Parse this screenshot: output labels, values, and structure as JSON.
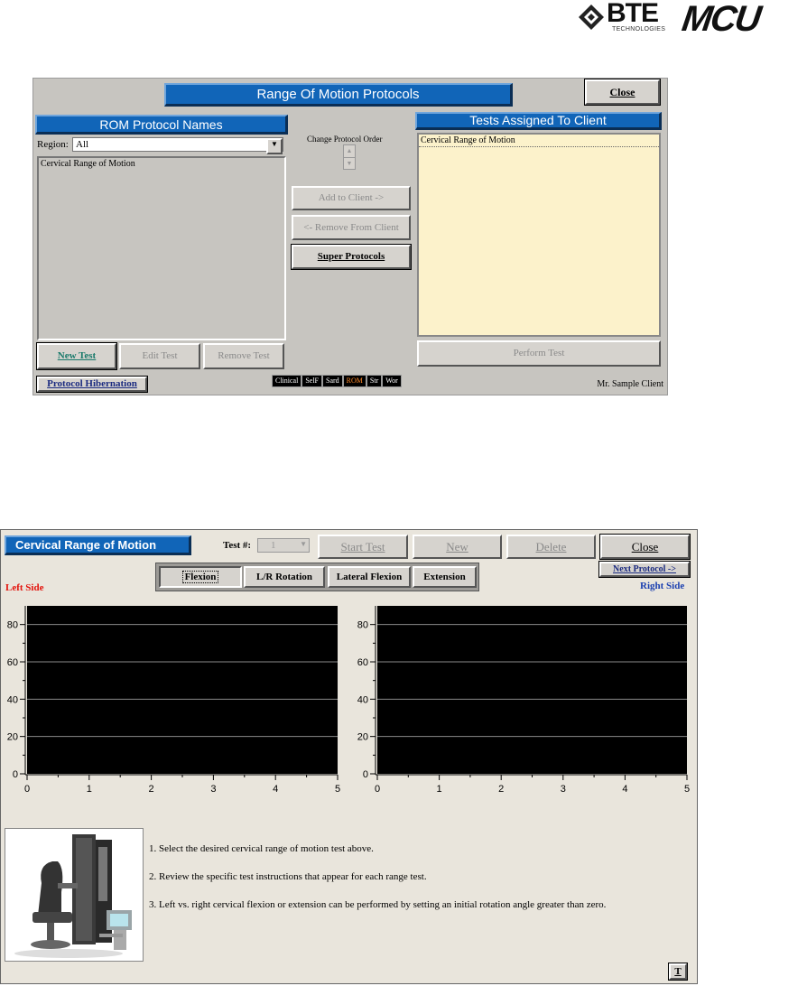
{
  "logos": {
    "bte_text": "BTE",
    "bte_subtext": "TECHNOLOGIES",
    "mcu_text": "MCU"
  },
  "protocols_window": {
    "title": "Range Of Motion Protocols",
    "close_label": "Close",
    "rom_names_header": "ROM Protocol Names",
    "region_label": "Region:",
    "region_value": "All",
    "protocol_names": [
      "Cervical Range of Motion"
    ],
    "change_order_label": "Change Protocol Order",
    "add_to_client_label": "Add to Client ->",
    "remove_from_client_label": "<- Remove From Client",
    "super_protocols_label": "Super Protocols",
    "tests_assigned_header": "Tests Assigned To Client",
    "assigned_tests": [
      "Cervical Range of Motion"
    ],
    "new_test_label": "New Test",
    "edit_test_label": "Edit Test",
    "remove_test_label": "Remove Test",
    "perform_test_label": "Perform Test",
    "protocol_hibernation_label": "Protocol Hibernation",
    "modules": [
      "Clinical",
      "SelF",
      "Sard",
      "ROM",
      "Str",
      "Wor"
    ],
    "active_module": "ROM",
    "client_name": "Mr. Sample Client"
  },
  "test_window": {
    "title": "Cervical Range of Motion",
    "test_number_label": "Test #:",
    "test_number_value": "1",
    "start_test_label": "Start Test",
    "new_label": "New",
    "delete_label": "Delete",
    "close_label": "Close",
    "tabs": [
      "Flexion",
      "L/R Rotation",
      "Lateral Flexion",
      "Extension"
    ],
    "active_tab": "Flexion",
    "next_protocol_label": "Next Protocol ->",
    "left_side_label": "Left Side",
    "right_side_label": "Right Side",
    "instructions": [
      "1. Select the desired cervical range of motion test above.",
      "2. Review the specific test instructions that appear for each range test.",
      "3. Left vs. right cervical flexion or extension can be performed by setting an initial rotation angle greater than zero."
    ],
    "t_button_label": "T",
    "colors": {
      "left_side": "#e3120b",
      "right_side": "#1a3fb0",
      "plot_bg": "#000000",
      "title_bg": "#1165b8"
    }
  },
  "chart_data": [
    {
      "type": "line",
      "title": "",
      "xlabel": "",
      "ylabel": "",
      "xlim": [
        0,
        5
      ],
      "ylim": [
        0,
        90
      ],
      "x_ticks": [
        "0",
        "1",
        "2",
        "3",
        "4",
        "5"
      ],
      "y_ticks": [
        "0",
        "20",
        "40",
        "60",
        "80"
      ],
      "grid": true,
      "series": []
    },
    {
      "type": "line",
      "title": "",
      "xlabel": "",
      "ylabel": "",
      "xlim": [
        0,
        5
      ],
      "ylim": [
        0,
        90
      ],
      "x_ticks": [
        "0",
        "1",
        "2",
        "3",
        "4",
        "5"
      ],
      "y_ticks": [
        "0",
        "20",
        "40",
        "60",
        "80"
      ],
      "grid": true,
      "series": []
    }
  ]
}
